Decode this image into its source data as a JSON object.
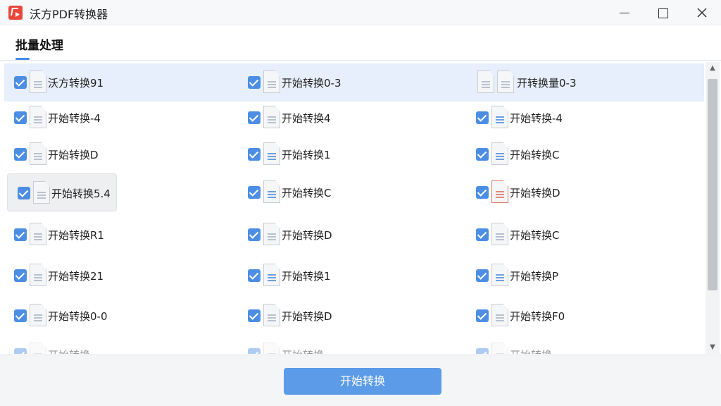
{
  "window": {
    "title": "沃方PDF转换器",
    "accent_color": "#3f8be6",
    "logo_color": "#e8473a"
  },
  "tabs": [
    {
      "label": "批量处理",
      "active": true
    }
  ],
  "file_rows": [
    [
      "沃方转换91",
      "开始转换0-3",
      "开转换量0-3"
    ],
    [
      "开始转换-4",
      "开始转换4",
      "开始转换-4"
    ],
    [
      "开始转换D",
      "开始转换1",
      "开始转换C"
    ],
    [
      "开始转换5.4",
      "开始转换C",
      "开始转换D"
    ],
    [
      "开始转换R1",
      "开始转换D",
      "开始转换C"
    ],
    [
      "开始转换21",
      "开始转换1",
      "开始转换P"
    ],
    [
      "开始转换0-0",
      "开始转换D",
      "开始转换F0"
    ],
    [
      "开始转换",
      "开始转换",
      "开始转换"
    ]
  ],
  "footer": {
    "start_button_label": "开始转换",
    "button_color": "#5b9be8"
  },
  "icons": {
    "window_controls": [
      "minimize-icon",
      "maximize-icon",
      "close-icon"
    ],
    "file": "document-icon",
    "checkbox": "checkbox-checked-icon"
  }
}
